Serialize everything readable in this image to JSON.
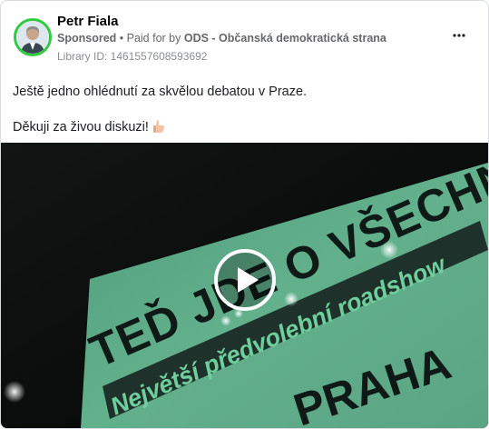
{
  "advertiser": {
    "name": "Petr Fiala",
    "sponsored": "Sponsored",
    "paid_prefix": " • Paid for by ",
    "payer": "ODS - Občanská demokratická strana",
    "library_id": "Library ID: 1461557608593692"
  },
  "post": {
    "line1": "Ještě jedno ohlédnutí za skvělou debatou v Praze.",
    "line2": "Děkuji za živou diskuzi!"
  },
  "video": {
    "line_top": "TEĎ JDE O VŠECHNO!",
    "line_middle": "Největší předvolební roadshow",
    "line_bottom": "PRAHA"
  },
  "colors": {
    "avatar_ring": "#2ecc40",
    "billboard": "#5fae8a",
    "banner": "#1b2a26"
  },
  "icons": {
    "more": "more-dots-icon",
    "play": "play-icon",
    "thumbs": "thumbs-up-emoji"
  }
}
